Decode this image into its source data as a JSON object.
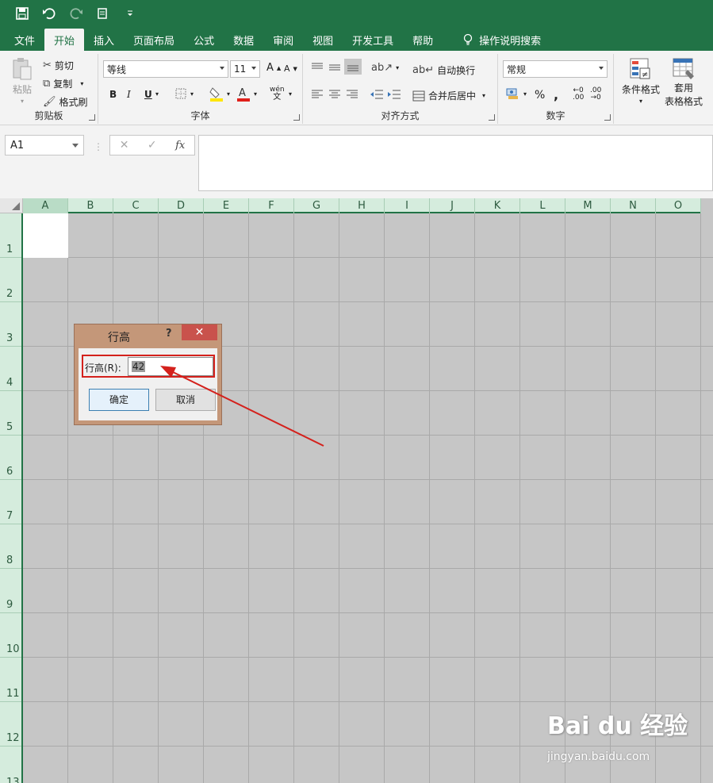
{
  "qat": {
    "save_icon": "save-icon",
    "undo_icon": "undo-icon",
    "redo_icon": "redo-icon",
    "print_icon": "print-preview-icon",
    "customize_icon": "customize-icon"
  },
  "tabs": [
    {
      "label": "文件"
    },
    {
      "label": "开始"
    },
    {
      "label": "插入"
    },
    {
      "label": "页面布局"
    },
    {
      "label": "公式"
    },
    {
      "label": "数据"
    },
    {
      "label": "审阅"
    },
    {
      "label": "视图"
    },
    {
      "label": "开发工具"
    },
    {
      "label": "帮助"
    }
  ],
  "tellme": {
    "label": "操作说明搜索",
    "icon": "lightbulb-icon"
  },
  "ribbon": {
    "clipboard": {
      "paste": "粘贴",
      "cut": "剪切",
      "copy": "复制",
      "format_painter": "格式刷",
      "label": "剪贴板"
    },
    "font": {
      "font_name": "等线",
      "font_size": "11",
      "bold": "B",
      "italic": "I",
      "underline": "U",
      "phonetic": "wén",
      "phonetic_sub": "文",
      "label": "字体"
    },
    "alignment": {
      "wrap_text": "自动换行",
      "merge_center": "合并后居中",
      "label": "对齐方式"
    },
    "number": {
      "format": "常规",
      "percent": "%",
      "comma": ",",
      "label": "数字"
    },
    "styles": {
      "conditional": "条件格式",
      "table_format_1": "套用",
      "table_format_2": "表格格式"
    }
  },
  "formula_bar": {
    "name_box": "A1",
    "cancel": "✕",
    "enter": "✓",
    "fx": "fx",
    "value": ""
  },
  "sheet": {
    "columns": [
      "A",
      "B",
      "C",
      "D",
      "E",
      "F",
      "G",
      "H",
      "I",
      "J",
      "K",
      "L",
      "M",
      "N",
      "O"
    ],
    "rows": [
      "1",
      "2",
      "3",
      "4",
      "5",
      "6",
      "7",
      "8",
      "9",
      "10",
      "11",
      "12",
      "13"
    ]
  },
  "dialog": {
    "title": "行高",
    "help": "?",
    "close": "✕",
    "field_label": "行高(R):",
    "field_value": "42",
    "ok": "确定",
    "cancel": "取消"
  },
  "watermark": {
    "main": "Bai du 经验",
    "sub": "jingyan.baidu.com"
  },
  "colors": {
    "brand": "#217346",
    "dialog_frame": "#c49779",
    "close_button": "#c9524c",
    "annotation": "#d4211c"
  }
}
